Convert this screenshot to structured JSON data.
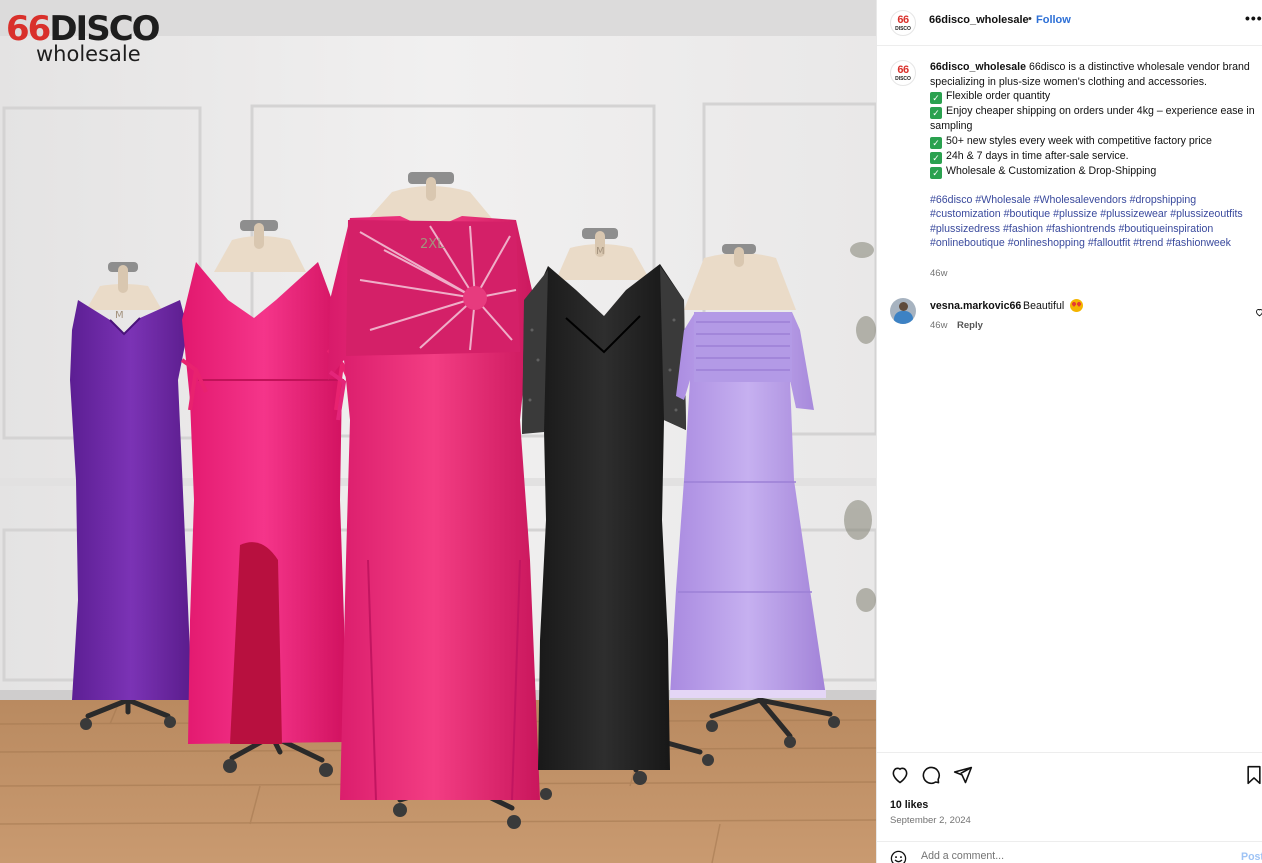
{
  "brand": {
    "logo_number": "66",
    "logo_word": "DISCO",
    "logo_subtitle": "wholesale"
  },
  "post": {
    "username": "66disco_wholesale",
    "separator": "•",
    "follow_label": "Follow",
    "more_label": "•••",
    "avatar_top": "66",
    "avatar_bottom": "DISCO",
    "caption_intro": "66disco is a distinctive wholesale vendor brand specializing in plus-size women's clothing and accessories.",
    "caption_points": [
      "Flexible order quantity",
      "Enjoy cheaper shipping on orders under 4kg – experience ease in sampling",
      "50+ new styles every week with competitive factory price",
      "24h & 7 days in time after-sale service.",
      "Wholesale & Customization & Drop-Shipping"
    ],
    "hashtags": "#66disco #Wholesale #Wholesalevendors #dropshipping #customization #boutique #plussize #plussizewear #plussizeoutfits #plussizedress #fashion #fashiontrends #boutiqueinspiration #onlineboutique #onlineshopping #falloutfit #trend #fashionweek",
    "caption_time": "46w",
    "check_icon": "✓"
  },
  "comment": {
    "username": "vesna.markovic66",
    "text": "Beautiful",
    "time": "46w",
    "reply_label": "Reply"
  },
  "engagement": {
    "likes": "10 likes",
    "date": "September 2, 2024",
    "comment_placeholder": "Add a comment...",
    "post_label": "Post"
  },
  "icons": {
    "like": "heart-icon",
    "comment": "speech-bubble-icon",
    "share": "paper-plane-icon",
    "save": "bookmark-icon",
    "emoji": "smiley-icon"
  },
  "colors": {
    "accent_link": "#2c6fd6",
    "hashtag": "#3a4a9d",
    "brand_red": "#d9302b",
    "muted_text": "#737373"
  }
}
